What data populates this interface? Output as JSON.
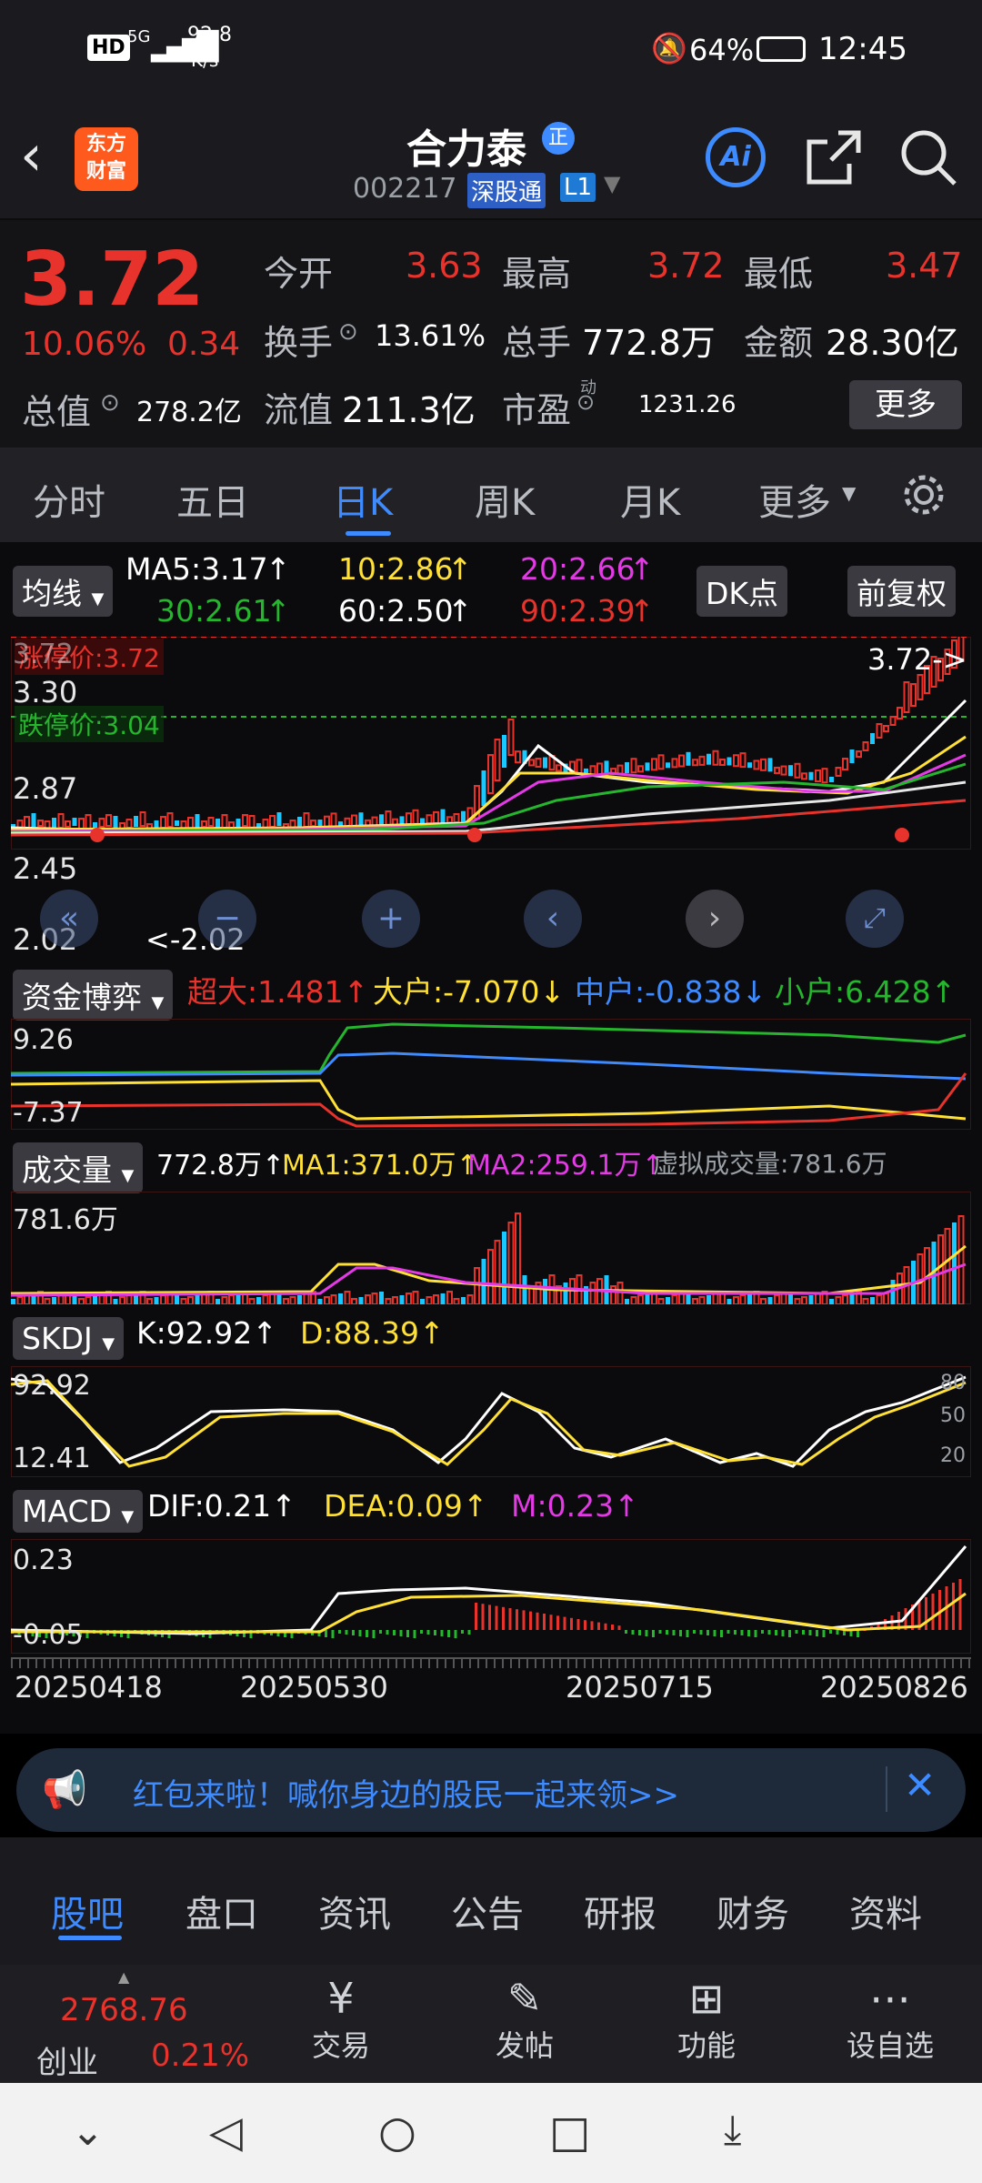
{
  "status": {
    "net": "HD",
    "signal": "5G",
    "speed": "92.8",
    "speed_unit": "K/s",
    "battery": "64%",
    "time": "12:45"
  },
  "header": {
    "logo_top": "东方",
    "logo_bottom": "财富",
    "name": "合力泰",
    "badge": "正",
    "code": "002217",
    "exchange": "深股通",
    "level": "L1",
    "ai": "Ai"
  },
  "quote": {
    "price": "3.72",
    "pct": "10.06%",
    "chg": "0.34",
    "open_label": "今开",
    "open": "3.63",
    "high_label": "最高",
    "high": "3.72",
    "low_label": "最低",
    "low": "3.47",
    "turnover_label": "换手",
    "turnover": "13.61%",
    "volume_label": "总手",
    "volume": "772.8万",
    "amount_label": "金额",
    "amount": "28.30亿",
    "mktcap_label": "总值",
    "mktcap": "278.2亿",
    "float_label": "流值",
    "float": "211.3亿",
    "pe_label": "市盈",
    "pe_sup": "动",
    "pe": "1231.26",
    "more": "更多"
  },
  "tabs": [
    "分时",
    "五日",
    "日K",
    "周K",
    "月K",
    "更多"
  ],
  "ma": {
    "select": "均线",
    "ma5": "MA5:3.17",
    "ma10": "10:2.86",
    "ma20": "20:2.66",
    "ma30": "30:2.61",
    "ma60": "60:2.50",
    "ma90": "90:2.39",
    "dk": "DK点",
    "fq": "前复权"
  },
  "kline": {
    "limit_up": "涨停价:3.72",
    "limit_down": "跌停价:3.04",
    "y1": "3.72",
    "y2": "3.30",
    "y3": "2.87",
    "y4": "2.45",
    "y5": "2.02",
    "last": "3.72->",
    "low_mark": "2.02"
  },
  "fund": {
    "select": "资金博弈",
    "super": "超大:1.481",
    "large": "大户:-7.070",
    "mid": "中户:-0.838",
    "small": "小户:6.428",
    "ymax": "9.26",
    "ymin": "-7.37"
  },
  "vol": {
    "select": "成交量",
    "vol": "772.8万",
    "ma1": "MA1:371.0万",
    "ma2": "MA2:259.1万",
    "virtual": "虚拟成交量:781.6万",
    "ymax": "781.6万"
  },
  "skdj": {
    "select": "SKDJ",
    "k": "K:92.92",
    "d": "D:88.39",
    "ymax": "92.92",
    "ymin": "12.41",
    "l80": "80",
    "l50": "50",
    "l20": "20"
  },
  "macd": {
    "select": "MACD",
    "dif": "DIF:0.21",
    "dea": "DEA:0.09",
    "m": "M:0.23",
    "ymax": "0.23",
    "ymin": "-0.05"
  },
  "dates": [
    "20250418",
    "20250530",
    "20250715",
    "20250826"
  ],
  "banner": {
    "text": "红包来啦！喊你身边的股民一起来领>>"
  },
  "subtabs": [
    "股吧",
    "盘口",
    "资讯",
    "公告",
    "研报",
    "财务",
    "资料"
  ],
  "bottom": {
    "index_value": "2768.76",
    "index_name": "创业",
    "index_pct": "0.21%",
    "items": [
      "交易",
      "发帖",
      "功能",
      "设自选"
    ]
  },
  "colors": {
    "up": "#e8322c",
    "down": "#19c8ff",
    "accent": "#3e8bff",
    "ma10": "#ffe036",
    "ma20": "#e43ae6",
    "ma30": "#25b62e"
  }
}
